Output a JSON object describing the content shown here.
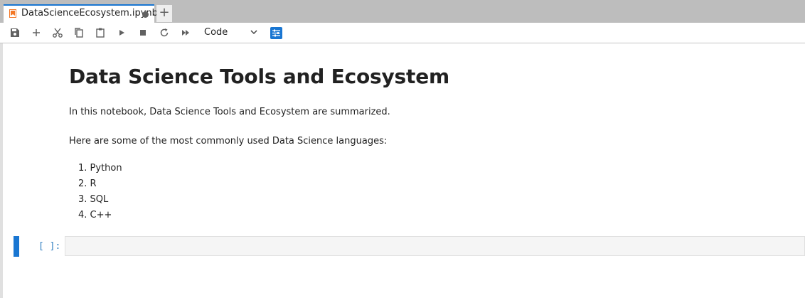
{
  "tab": {
    "label": "DataScienceEcosystem.ipynb",
    "new_tab": "+"
  },
  "toolbar": {
    "cell_type": "Code",
    "icons": [
      "save-icon",
      "add-icon",
      "cut-icon",
      "copy-icon",
      "paste-icon",
      "run-icon",
      "stop-icon",
      "restart-icon",
      "run-all-icon",
      "chevron-down-icon",
      "property-inspector-icon"
    ]
  },
  "notebook": {
    "heading": "Data Science Tools and Ecosystem",
    "intro": "In this notebook, Data Science Tools and Ecosystem are summarized.",
    "languages_intro": "Here are some of the most commonly used Data Science languages:",
    "languages": [
      "1. Python",
      "2. R",
      "3. SQL",
      "4. C++"
    ],
    "code_cell": {
      "prompt": "[ ]:",
      "value": ""
    }
  },
  "colors": {
    "accent": "#1976d2",
    "prompt": "#307fc1",
    "tabbar": "#bdbdbd"
  }
}
